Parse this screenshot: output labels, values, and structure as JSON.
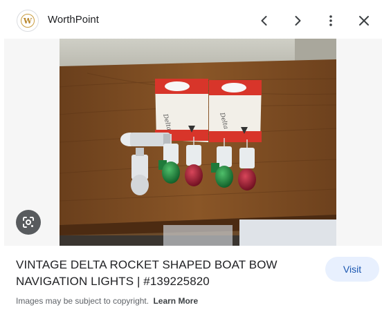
{
  "header": {
    "site_name": "WorthPoint",
    "logo_letter": "W"
  },
  "icons": {
    "prev": "chevron-left-icon",
    "next": "chevron-right-icon",
    "more": "more-vert-icon",
    "close": "close-icon",
    "lens": "google-lens-icon"
  },
  "image": {
    "product_box_label": "Delta"
  },
  "caption": {
    "title": "VINTAGE DELTA ROCKET SHAPED BOAT BOW NAVIGATION LIGHTS | #139225820",
    "visit_label": "Visit",
    "copyright_text": "Images may be subject to copyright.",
    "learn_more_label": "Learn More"
  },
  "colors": {
    "accent": "#1a56b0",
    "visit_bg": "#e8f0fe",
    "text": "#202124",
    "muted": "#5f6368"
  }
}
